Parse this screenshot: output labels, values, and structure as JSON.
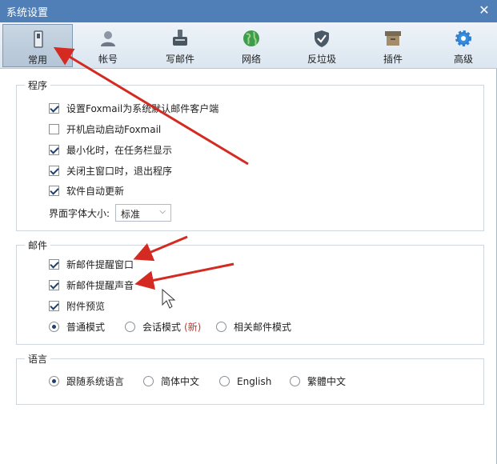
{
  "window": {
    "title": "系统设置",
    "close_icon": "close-icon"
  },
  "toolbar": {
    "items": [
      {
        "label": "常用",
        "icon": "general-icon",
        "active": true
      },
      {
        "label": "帐号",
        "icon": "account-icon",
        "active": false
      },
      {
        "label": "写邮件",
        "icon": "compose-icon",
        "active": false
      },
      {
        "label": "网络",
        "icon": "globe-icon",
        "active": false
      },
      {
        "label": "反垃圾",
        "icon": "shield-icon",
        "active": false
      },
      {
        "label": "插件",
        "icon": "plugin-box-icon",
        "active": false
      },
      {
        "label": "高级",
        "icon": "gear-icon",
        "active": false
      }
    ]
  },
  "program": {
    "legend": "程序",
    "options": [
      {
        "label": "设置Foxmail为系统默认邮件客户端",
        "checked": true
      },
      {
        "label": "开机启动启动Foxmail",
        "checked": false
      },
      {
        "label": "最小化时，在任务栏显示",
        "checked": true
      },
      {
        "label": "关闭主窗口时，退出程序",
        "checked": true
      },
      {
        "label": "软件自动更新",
        "checked": true
      }
    ],
    "font_size_label": "界面字体大小:",
    "font_size_value": "标准"
  },
  "mail": {
    "legend": "邮件",
    "options": [
      {
        "label": "新邮件提醒窗口",
        "checked": true
      },
      {
        "label": "新邮件提醒声音",
        "checked": true
      },
      {
        "label": "附件预览",
        "checked": true
      }
    ],
    "modes": [
      {
        "label": "普通模式",
        "selected": true
      },
      {
        "label": "会话模式",
        "selected": false,
        "badge": "(新)"
      },
      {
        "label": "相关邮件模式",
        "selected": false
      }
    ]
  },
  "language": {
    "legend": "语言",
    "options": [
      {
        "label": "跟随系统语言",
        "selected": true
      },
      {
        "label": "简体中文",
        "selected": false
      },
      {
        "label": "English",
        "selected": false
      },
      {
        "label": "繁體中文",
        "selected": false
      }
    ]
  },
  "colors": {
    "titlebar": "#4f7fb6",
    "arrow": "#d42a22",
    "new_badge": "#c0392b"
  }
}
